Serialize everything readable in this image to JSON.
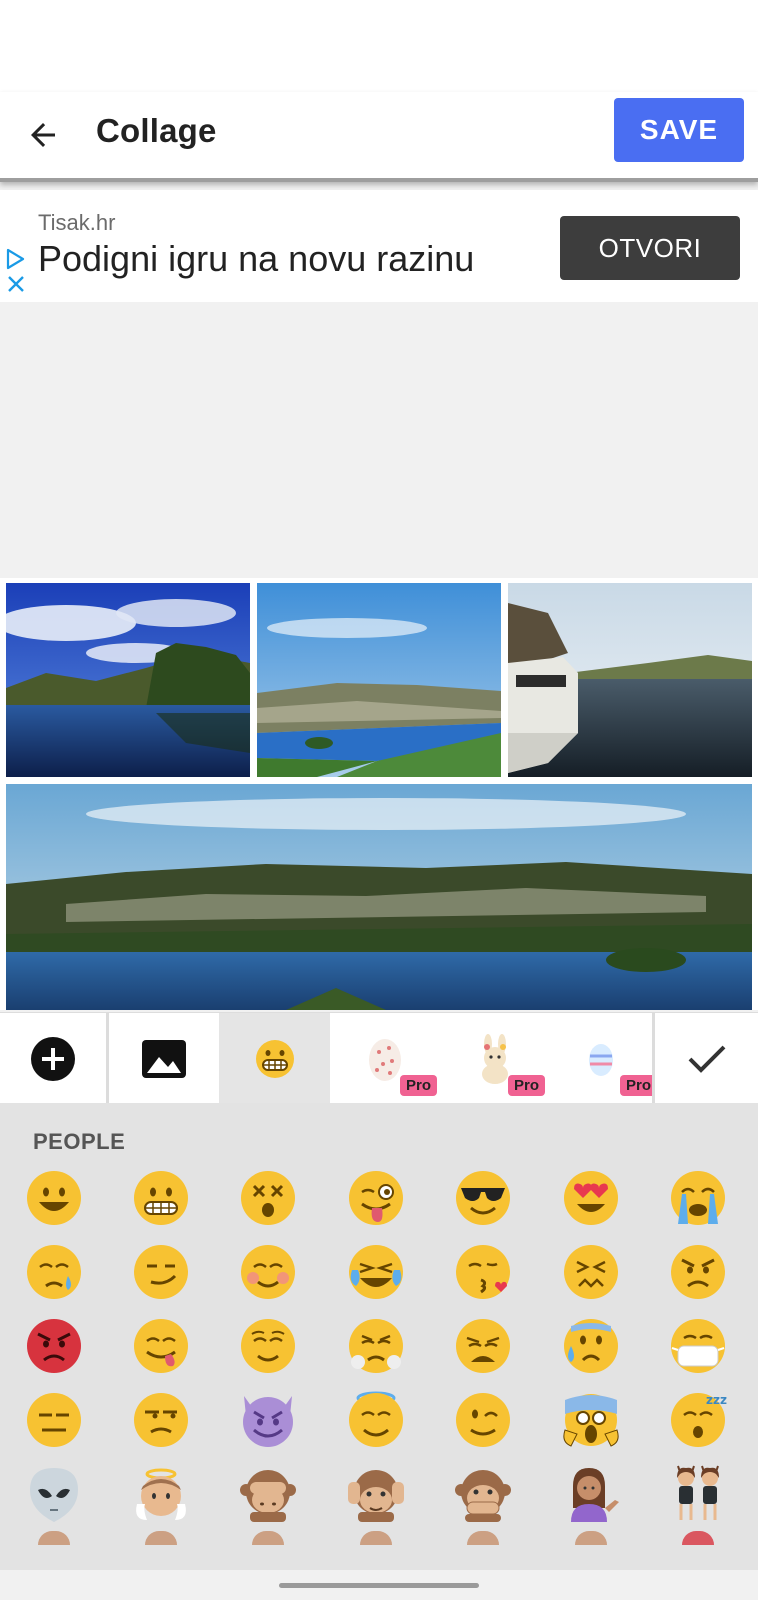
{
  "app_bar": {
    "title": "Collage",
    "save_label": "SAVE",
    "back_icon": "arrow-back-icon"
  },
  "ad": {
    "source": "Tisak.hr",
    "headline": "Podigni igru na novu razinu",
    "cta": "OTVORI"
  },
  "collage": {
    "photos": [
      "lake-with-clouds",
      "lake-with-island",
      "boat-on-river",
      "panorama-lake-hills"
    ]
  },
  "sticker_tabs": {
    "items": [
      "add-icon",
      "image-icon",
      "grimace-emoji-icon",
      "egg-sticker-pack",
      "bunny-sticker-pack",
      "easter-egg-sticker-pack",
      "check-icon"
    ],
    "pro_label": "Pro"
  },
  "emoji_panel": {
    "section": "PEOPLE",
    "emojis": [
      "smiley",
      "grimacing",
      "dizzy-face",
      "winking-tongue",
      "sunglasses",
      "heart-eyes",
      "loudly-crying",
      "sleepy",
      "smirk",
      "blush",
      "joy",
      "kissing-heart",
      "confounded",
      "angry",
      "rage",
      "yum",
      "relieved",
      "triumph",
      "weary",
      "cold-sweat",
      "mask",
      "expressionless",
      "unamused",
      "smiling-imp",
      "innocent",
      "wink",
      "scream",
      "sleeping",
      "alien",
      "baby-angel",
      "see-no-evil",
      "hear-no-evil",
      "speak-no-evil",
      "information-desk-person",
      "dancers"
    ]
  },
  "colors": {
    "accent": "#4a6ef2",
    "emoji_yellow": "#f7c232",
    "panel_bg": "#e3e3e3"
  }
}
